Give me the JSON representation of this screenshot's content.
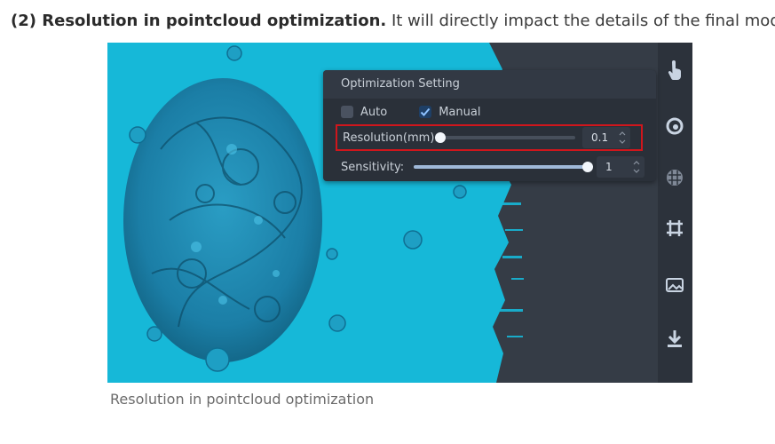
{
  "article": {
    "heading_bold": "(2) Resolution in pointcloud optimization.",
    "heading_rest": " It will directly impact the details of the final model.",
    "caption": "Resolution in pointcloud optimization"
  },
  "panel": {
    "title": "Optimization Setting",
    "mode_auto_label": "Auto",
    "mode_manual_label": "Manual",
    "mode_selected": "Manual",
    "resolution": {
      "label": "Resolution(mm):",
      "value": "0.1",
      "slider_level": 0.0
    },
    "sensitivity": {
      "label": "Sensitivity:",
      "value": "1",
      "slider_level": 1.0
    }
  },
  "toolbar_icons": [
    "hand-touch-icon",
    "lasso-select-icon",
    "mesh-icon",
    "crop-grid-icon",
    "image-texture-icon",
    "download-icon"
  ],
  "colors": {
    "point_cloud": "#16b8d8",
    "model": "#1a7fa5",
    "panel_bg": "#2a3039",
    "highlight_border": "#d0161c"
  }
}
